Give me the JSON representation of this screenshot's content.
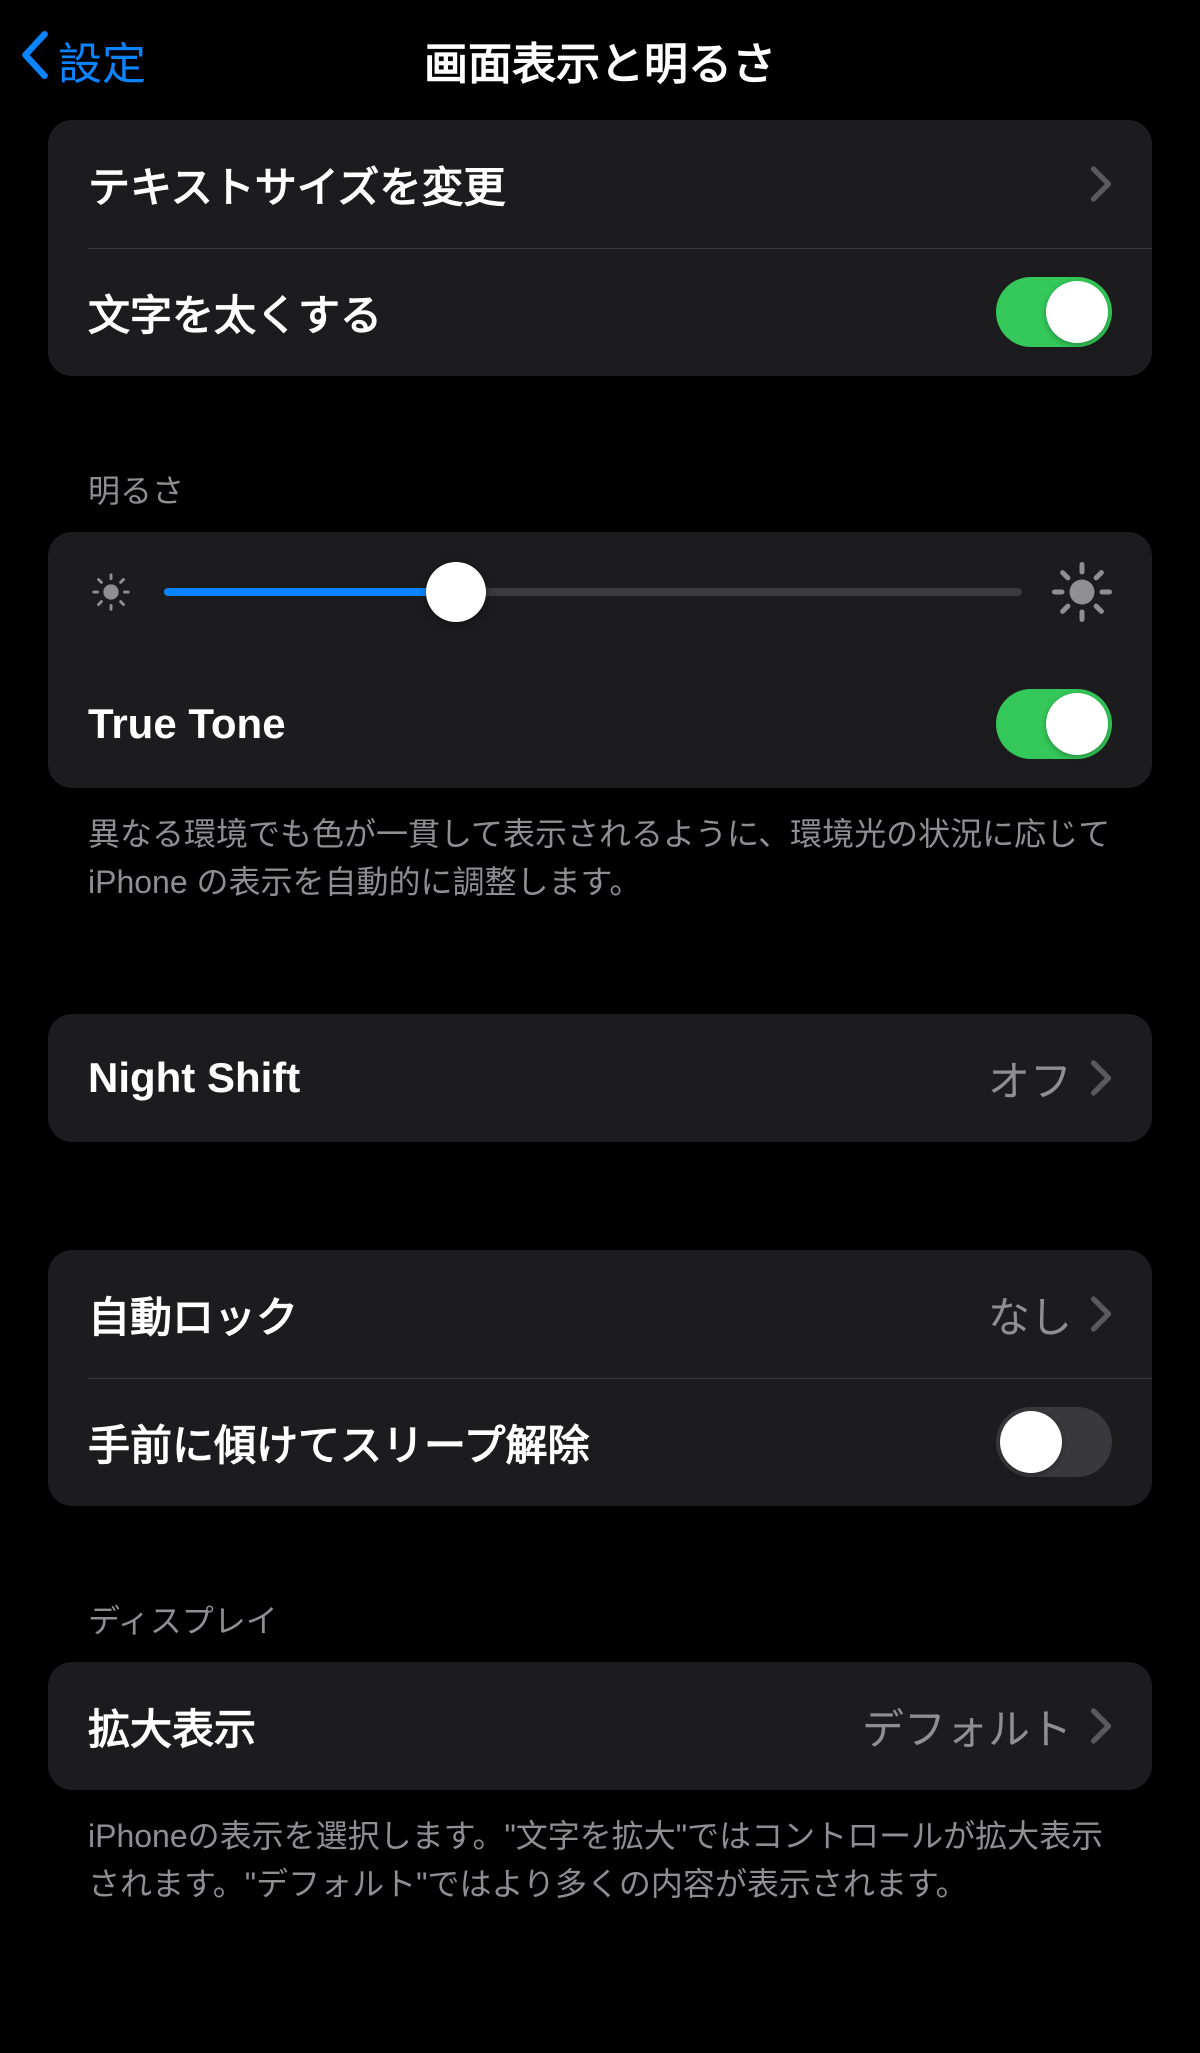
{
  "nav": {
    "back_label": "設定",
    "title": "画面表示と明るさ"
  },
  "text_group": {
    "text_size": "テキストサイズを変更",
    "bold_text": "文字を太くする",
    "bold_on": true
  },
  "brightness": {
    "header": "明るさ",
    "percent": 34,
    "true_tone": "True Tone",
    "true_tone_on": true,
    "true_tone_desc": "異なる環境でも色が一貫して表示されるように、環境光の状況に応じて iPhone の表示を自動的に調整します。"
  },
  "night_shift": {
    "label": "Night Shift",
    "value": "オフ"
  },
  "lock_group": {
    "auto_lock": "自動ロック",
    "auto_lock_value": "なし",
    "raise_to_wake": "手前に傾けてスリープ解除",
    "raise_on": false
  },
  "display": {
    "header": "ディスプレイ",
    "zoom_label": "拡大表示",
    "zoom_value": "デフォルト",
    "zoom_desc": "iPhoneの表示を選択します。\"文字を拡大\"ではコントロールが拡大表示されます。\"デフォルト\"ではより多くの内容が表示されます。"
  }
}
